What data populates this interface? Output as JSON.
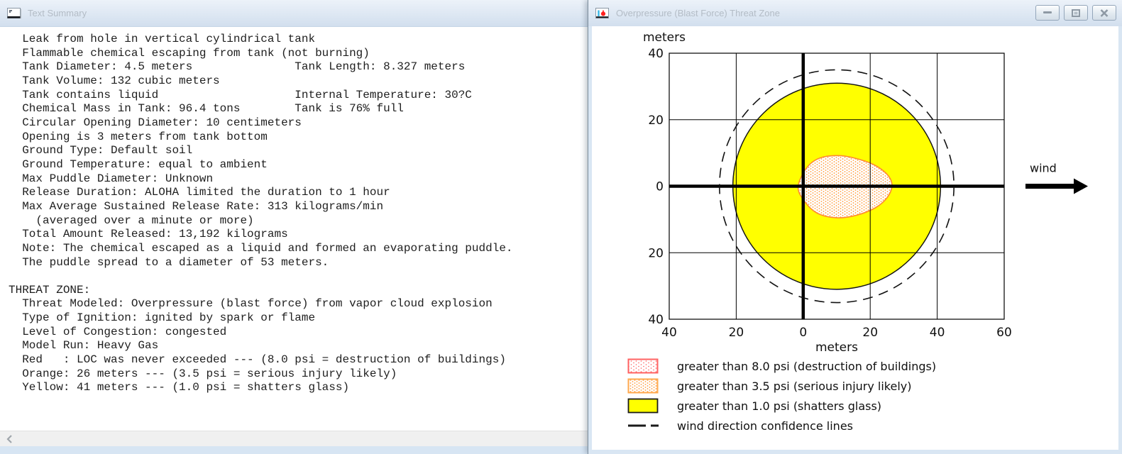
{
  "left_window": {
    "title": "Text Summary",
    "lines": [
      "  Leak from hole in vertical cylindrical tank",
      "  Flammable chemical escaping from tank (not burning)",
      "  Tank Diameter: 4.5 meters               Tank Length: 8.327 meters",
      "  Tank Volume: 132 cubic meters",
      "  Tank contains liquid                    Internal Temperature: 30?C",
      "  Chemical Mass in Tank: 96.4 tons        Tank is 76% full",
      "  Circular Opening Diameter: 10 centimeters",
      "  Opening is 3 meters from tank bottom",
      "  Ground Type: Default soil",
      "  Ground Temperature: equal to ambient",
      "  Max Puddle Diameter: Unknown",
      "  Release Duration: ALOHA limited the duration to 1 hour",
      "  Max Average Sustained Release Rate: 313 kilograms/min",
      "    (averaged over a minute or more)",
      "  Total Amount Released: 13,192 kilograms",
      "  Note: The chemical escaped as a liquid and formed an evaporating puddle.",
      "  The puddle spread to a diameter of 53 meters.",
      "",
      "THREAT ZONE:",
      "  Threat Modeled: Overpressure (blast force) from vapor cloud explosion",
      "  Type of Ignition: ignited by spark or flame",
      "  Level of Congestion: congested",
      "  Model Run: Heavy Gas",
      "  Red   : LOC was never exceeded --- (8.0 psi = destruction of buildings)",
      "  Orange: 26 meters --- (3.5 psi = serious injury likely)",
      "  Yellow: 41 meters --- (1.0 psi = shatters glass)"
    ]
  },
  "right_window": {
    "title": "Overpressure (Blast Force) Threat Zone",
    "legend": [
      {
        "swatch": "red-dotted",
        "label": "greater than 8.0 psi (destruction of buildings)"
      },
      {
        "swatch": "orange-dotted",
        "label": "greater than 3.5 psi (serious injury likely)"
      },
      {
        "swatch": "yellow-solid",
        "label": "greater than 1.0 psi (shatters glass)"
      },
      {
        "swatch": "dashed-line",
        "label": "wind direction confidence lines"
      }
    ]
  },
  "icons": {
    "text_summary_window": "document-icon",
    "threat_zone_window": "chart-icon",
    "minimize": "dash",
    "restore": "window-restore",
    "close": "x",
    "scroll_left": "chevron-left",
    "wind": "right-arrow"
  },
  "colors": {
    "yellow_zone": "#ffff00",
    "orange_outline": "#ff8c2e",
    "red_outline": "#ff5a5a",
    "titlebar_top": "#ecf2f9",
    "titlebar_bottom": "#d2dfee"
  },
  "chart_data": {
    "type": "area",
    "title": "Overpressure (Blast Force) Threat Zone",
    "xlabel": "meters",
    "ylabel": "meters",
    "xlim": [
      -40,
      60
    ],
    "ylim": [
      -40,
      40
    ],
    "x_ticks": [
      -40,
      -20,
      0,
      20,
      40,
      60
    ],
    "x_tick_labels": [
      "40",
      "20",
      "0",
      "20",
      "40",
      "60"
    ],
    "y_ticks": [
      -40,
      -20,
      0,
      20,
      40
    ],
    "y_tick_labels": [
      "40",
      "20",
      "0",
      "20",
      "40"
    ],
    "grid": true,
    "origin_axes_bold": true,
    "zones": [
      {
        "name": "red",
        "label": "greater than 8.0 psi (destruction of buildings)",
        "threshold_psi": 8.0,
        "downwind_extent_m": null,
        "note": "LOC was never exceeded",
        "fill": "red-dot-pattern",
        "outline_color": "#ff5a5a"
      },
      {
        "name": "orange",
        "label": "greater than 3.5 psi (serious injury likely)",
        "threshold_psi": 3.5,
        "downwind_extent_m": 26,
        "fill": "orange-dot-pattern",
        "outline_color": "#ff8c2e",
        "outline": [
          [
            -1.5,
            0
          ],
          [
            1,
            5.5
          ],
          [
            5,
            8.5
          ],
          [
            11,
            9.2
          ],
          [
            17,
            8
          ],
          [
            22,
            6
          ],
          [
            25.5,
            3
          ],
          [
            26.5,
            0
          ],
          [
            25,
            -3.5
          ],
          [
            21.5,
            -6.5
          ],
          [
            16,
            -8.7
          ],
          [
            10,
            -9.5
          ],
          [
            4,
            -8
          ],
          [
            0,
            -4
          ]
        ]
      },
      {
        "name": "yellow",
        "label": "greater than 1.0 psi (shatters glass)",
        "threshold_psi": 1.0,
        "downwind_extent_m": 41,
        "shape": "circle",
        "center": [
          10,
          0
        ],
        "radius": 31,
        "fill": "#ffff00",
        "outline_color": "#151515"
      }
    ],
    "wind_confidence": {
      "label": "wind direction confidence lines",
      "shape": "dashed-circle",
      "center": [
        10,
        0
      ],
      "radius": 35
    },
    "wind_arrow": {
      "label": "wind",
      "direction": "right"
    }
  }
}
